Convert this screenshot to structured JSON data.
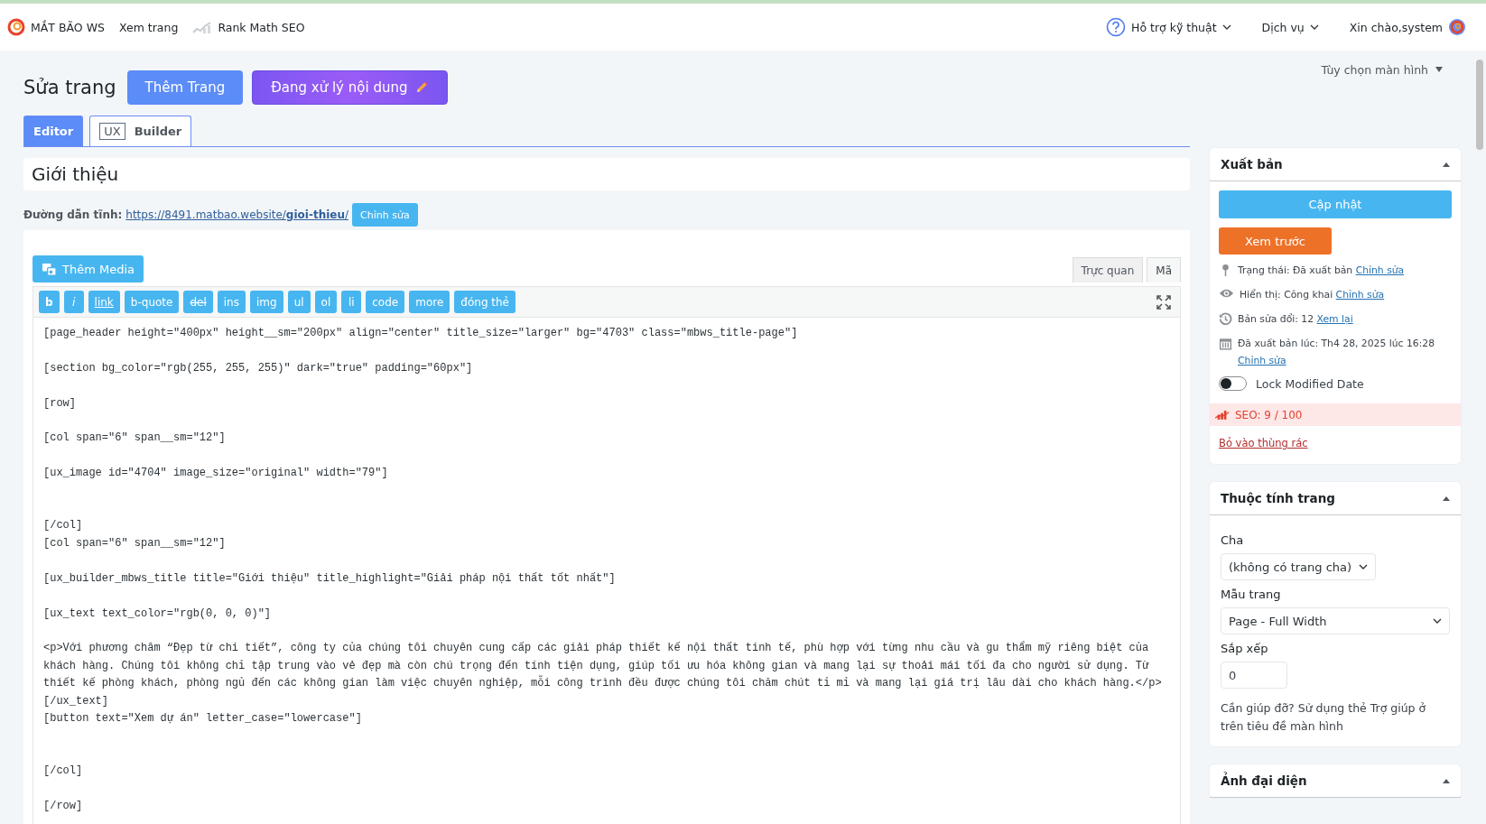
{
  "topbar": {
    "left": [
      {
        "kind": "logo",
        "label": "MẮT BÃO WS"
      },
      {
        "kind": "link",
        "label": "Xem trang"
      },
      {
        "kind": "seo",
        "label": "Rank Math SEO"
      }
    ],
    "right": [
      {
        "kind": "help",
        "label": "Hỗ trợ kỹ thuật"
      },
      {
        "kind": "menu",
        "label": "Dịch vụ"
      },
      {
        "kind": "user",
        "label": "Xin chào,system"
      }
    ]
  },
  "screen_options": "Tùy chọn màn hình",
  "heading": {
    "title": "Sửa trang",
    "buttons": [
      {
        "kind": "add",
        "label": "Thêm Trang"
      },
      {
        "kind": "ai",
        "label": "Đang xử lý nội dung"
      }
    ]
  },
  "tabs": [
    {
      "label": "Editor",
      "selected": true
    },
    {
      "label": "Builder",
      "badge": "UX",
      "selected": false
    }
  ],
  "post_title": "Giới thiệu",
  "permalink": {
    "label": "Đường dẫn tĩnh:",
    "url": "https://8491.matbao.website/**gioi-thieu**/",
    "edit": "Chỉnh sửa"
  },
  "editor": {
    "add_media": "Thêm Media",
    "modes": [
      {
        "label": "Trực quan",
        "selected": false
      },
      {
        "label": "Mã",
        "selected": true
      }
    ],
    "quicktags": [
      {
        "label": "b",
        "kind": "bold"
      },
      {
        "label": "i",
        "kind": "italic"
      },
      {
        "label": "link",
        "kind": "underline"
      },
      {
        "label": "b-quote",
        "kind": "plain"
      },
      {
        "label": "del",
        "kind": "strike"
      },
      {
        "label": "ins",
        "kind": "plain"
      },
      {
        "label": "img",
        "kind": "plain"
      },
      {
        "label": "ul",
        "kind": "plain"
      },
      {
        "label": "ol",
        "kind": "plain"
      },
      {
        "label": "li",
        "kind": "plain"
      },
      {
        "label": "code",
        "kind": "plain"
      },
      {
        "label": "more",
        "kind": "plain"
      },
      {
        "label": "đóng thẻ",
        "kind": "plain"
      }
    ],
    "content": "[page_header height=\"400px\" height__sm=\"200px\" align=\"center\" title_size=\"larger\" bg=\"4703\" class=\"mbws_title-page\"]\n\n[section bg_color=\"rgb(255, 255, 255)\" dark=\"true\" padding=\"60px\"]\n\n[row]\n\n[col span=\"6\" span__sm=\"12\"]\n\n[ux_image id=\"4704\" image_size=\"original\" width=\"79\"]\n\n\n[/col]\n[col span=\"6\" span__sm=\"12\"]\n\n[ux_builder_mbws_title title=\"Giới thiệu\" title_highlight=\"Giải pháp nội thất tốt nhất\"]\n\n[ux_text text_color=\"rgb(0, 0, 0)\"]\n\n<p>Với phương châm “Đẹp từ chi tiết”, công ty của chúng tôi chuyên cung cấp các giải pháp thiết kế nội thất tinh tế, phù hợp với từng nhu cầu và gu thẩm mỹ riêng biệt của khách hàng. Chúng tôi không chỉ tập trung vào vẻ đẹp mà còn chú trọng đến tính tiện dụng, giúp tối ưu hóa không gian và mang lại sự thoải mái tối đa cho người sử dụng. Từ thiết kế phòng khách, phòng ngủ đến các không gian làm việc chuyên nghiệp, mỗi công trình đều được chúng tôi chăm chút tỉ mỉ và mang lại giá trị lâu dài cho khách hàng.</p>\n[/ux_text]\n[button text=\"Xem dự án\" letter_case=\"lowercase\"]\n\n\n[/col]\n\n[/row]"
  },
  "publish": {
    "title": "Xuất bản",
    "update": "Cập nhật",
    "preview": "Xem trước",
    "meta": [
      {
        "kind": "status",
        "text": "Trạng thái: Đã xuất bản",
        "link": "Chỉnh sửa"
      },
      {
        "kind": "visibility",
        "text": "Hiển thị: Công khai",
        "link": "Chỉnh sửa"
      },
      {
        "kind": "revisions",
        "text": "Bản sửa đổi: 12",
        "link": "Xem lại"
      },
      {
        "kind": "date",
        "text": "Đã xuất bản lúc: Th4 28, 2025 lúc 16:28",
        "link": "Chỉnh sửa"
      }
    ],
    "lock": {
      "label": "Lock Modified Date",
      "on": false
    },
    "seo": "SEO: 9 / 100",
    "trash": "Bỏ vào thùng rác"
  },
  "attributes": {
    "title": "Thuộc tính trang",
    "parent_label": "Cha",
    "parent": "(không có trang cha)",
    "template_label": "Mẫu trang",
    "template": "Page - Full Width",
    "order_label": "Sắp xếp",
    "order": "0",
    "help": "Cần giúp đỡ? Sử dụng thẻ Trợ giúp ở trên tiêu đề màn hình"
  },
  "featured": {
    "title": "Ảnh đại diện"
  }
}
